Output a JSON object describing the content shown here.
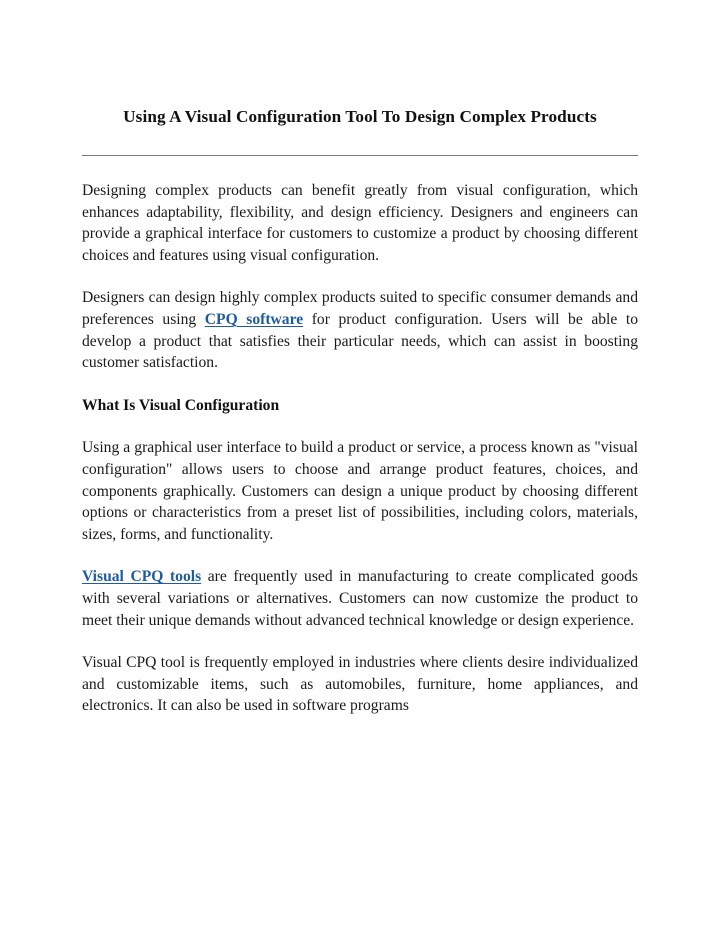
{
  "document": {
    "title": "Using A Visual Configuration Tool To Design Complex Products",
    "divider": "horizontal-rule",
    "link_color": "#1f5c9e",
    "text_color": "#1a1a1a",
    "background_color": "#ffffff",
    "blocks": [
      {
        "type": "paragraph",
        "id": "para-1",
        "text": "Designing complex products can benefit greatly from visual configuration, which enhances adaptability, flexibility, and design efficiency. Designers and engineers can provide a graphical interface for customers to customize a product by choosing different choices and features using visual configuration."
      },
      {
        "type": "paragraph-with-link",
        "id": "para-2",
        "text_before": "Designers can design highly complex products suited to specific consumer demands and preferences using ",
        "link_text": "CPQ software",
        "text_after": " for product configuration. Users will be able to develop a product that satisfies their particular needs, which can assist in boosting customer satisfaction."
      },
      {
        "type": "heading",
        "id": "heading-1",
        "text": "What Is Visual Configuration"
      },
      {
        "type": "paragraph",
        "id": "para-3",
        "text": "Using a graphical user interface to build a product or service, a process known as \"visual configuration\" allows users to choose and arrange product features, choices, and components graphically. Customers can design a unique product by choosing different options or characteristics from a preset list of possibilities, including colors, materials, sizes, forms, and functionality."
      },
      {
        "type": "paragraph-with-link",
        "id": "para-4",
        "text_before": "",
        "link_text": "Visual CPQ tools",
        "text_after": " are frequently used in manufacturing to create complicated goods with several variations or alternatives. Customers can now customize the product to meet their unique demands without advanced technical knowledge or design experience."
      },
      {
        "type": "paragraph",
        "id": "para-5",
        "text": "Visual CPQ tool is frequently employed in industries where clients desire individualized and customizable items, such as automobiles, furniture, home appliances, and electronics. It can also be used in software programs"
      }
    ]
  }
}
